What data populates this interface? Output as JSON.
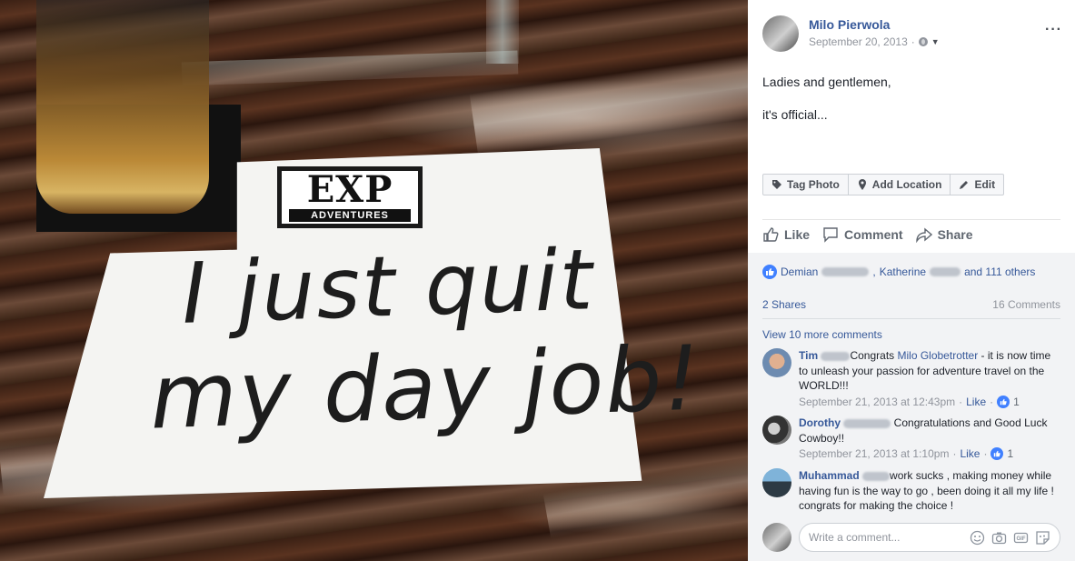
{
  "photo": {
    "logo_main": "EXP",
    "logo_sub": "ADVENTURES",
    "handwriting_line1": "I just quit",
    "handwriting_line2": "my day job!"
  },
  "post": {
    "author": "Milo Pierwola",
    "date": "September 20, 2013",
    "more_icon": "···",
    "text_line1": "Ladies and gentlemen,",
    "text_line2": "it's official..."
  },
  "photo_actions": {
    "tag_photo": "Tag Photo",
    "add_location": "Add Location",
    "edit": "Edit"
  },
  "actions": {
    "like": "Like",
    "comment": "Comment",
    "share": "Share"
  },
  "reactions": {
    "name1": "Demian",
    "sep": ",",
    "name2": "Katherine",
    "others": "and 111 others"
  },
  "stats": {
    "shares": "2 Shares",
    "comments": "16 Comments"
  },
  "view_more": "View 10 more comments",
  "comments": [
    {
      "name": "Tim",
      "text_prefix": "Congrats ",
      "tagged": "Milo Globetrotter",
      "text": " - it is now time to unleash your passion for adventure travel on the WORLD!!!",
      "time": "September 21, 2013 at 12:43pm",
      "like_label": "Like",
      "reaction_count": "1"
    },
    {
      "name": "Dorothy",
      "text": " Congratulations and Good Luck Cowboy!!",
      "time": "September 21, 2013 at 1:10pm",
      "like_label": "Like",
      "reaction_count": "1"
    },
    {
      "name": "Muhammad",
      "text": "work sucks , making money while having fun is the way to go , been doing it all my life ! congrats for making the choice !"
    }
  ],
  "write_comment": {
    "placeholder": "Write a comment..."
  },
  "colors": {
    "link": "#365899",
    "meta": "#90949c",
    "like_blue": "#4080ff",
    "gray_bg": "#f2f3f5"
  }
}
